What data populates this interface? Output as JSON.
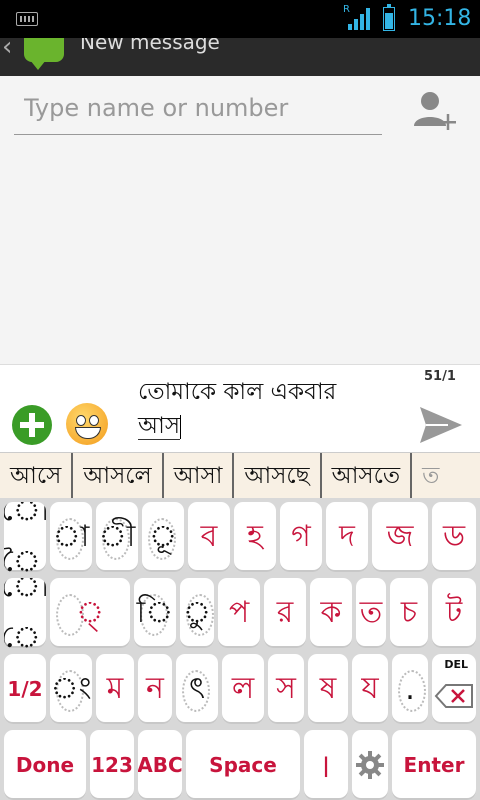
{
  "status_bar": {
    "time": "15:18",
    "roaming": "R"
  },
  "action_bar": {
    "title": "New message"
  },
  "recipient": {
    "placeholder": "Type name or number"
  },
  "compose": {
    "counter": "51/1",
    "line1": "তোমাকে কাল একবার",
    "composing": "আস"
  },
  "suggestions": [
    "আসে",
    "আসলে",
    "আসা",
    "আসছে",
    "আসতে",
    "ত"
  ],
  "keyboard": {
    "row1": [
      {
        "label": "ৌ ৈ",
        "style": "dark"
      },
      {
        "label": "া",
        "style": "dark"
      },
      {
        "label": "ী",
        "style": "dark"
      },
      {
        "label": "ূ",
        "style": "dark"
      },
      {
        "label": "ব",
        "style": "red"
      },
      {
        "label": "হ",
        "style": "red"
      },
      {
        "label": "গ",
        "style": "red"
      },
      {
        "label": "দ",
        "style": "red"
      },
      {
        "label": "জ",
        "style": "red"
      },
      {
        "label": "ড",
        "style": "red"
      }
    ],
    "row2": [
      {
        "label": "ো ে",
        "style": "dark"
      },
      {
        "label": "্",
        "style": "red"
      },
      {
        "label": "ি",
        "style": "dark"
      },
      {
        "label": "ু",
        "style": "dark"
      },
      {
        "label": "প",
        "style": "red"
      },
      {
        "label": "র",
        "style": "red"
      },
      {
        "label": "ক",
        "style": "red"
      },
      {
        "label": "ত",
        "style": "red"
      },
      {
        "label": "চ",
        "style": "red"
      },
      {
        "label": "ট",
        "style": "red"
      }
    ],
    "row3": [
      {
        "label": "1/2",
        "style": "fn"
      },
      {
        "label": "ং",
        "style": "dark"
      },
      {
        "label": "ম",
        "style": "red"
      },
      {
        "label": "ন",
        "style": "red"
      },
      {
        "label": "ৎ",
        "style": "dark"
      },
      {
        "label": "ল",
        "style": "red"
      },
      {
        "label": "স",
        "style": "red"
      },
      {
        "label": "ষ",
        "style": "red"
      },
      {
        "label": "য",
        "style": "red"
      },
      {
        "label": ".",
        "style": "dark"
      }
    ],
    "del_label": "DEL",
    "row4": {
      "done": "Done",
      "num": "123",
      "abc": "ABC",
      "space": "Space",
      "pipe": "|",
      "enter": "Enter"
    }
  },
  "colors": {
    "accent": "#33b5e5",
    "key_text": "#c8143c",
    "add_button": "#3a9c27"
  }
}
